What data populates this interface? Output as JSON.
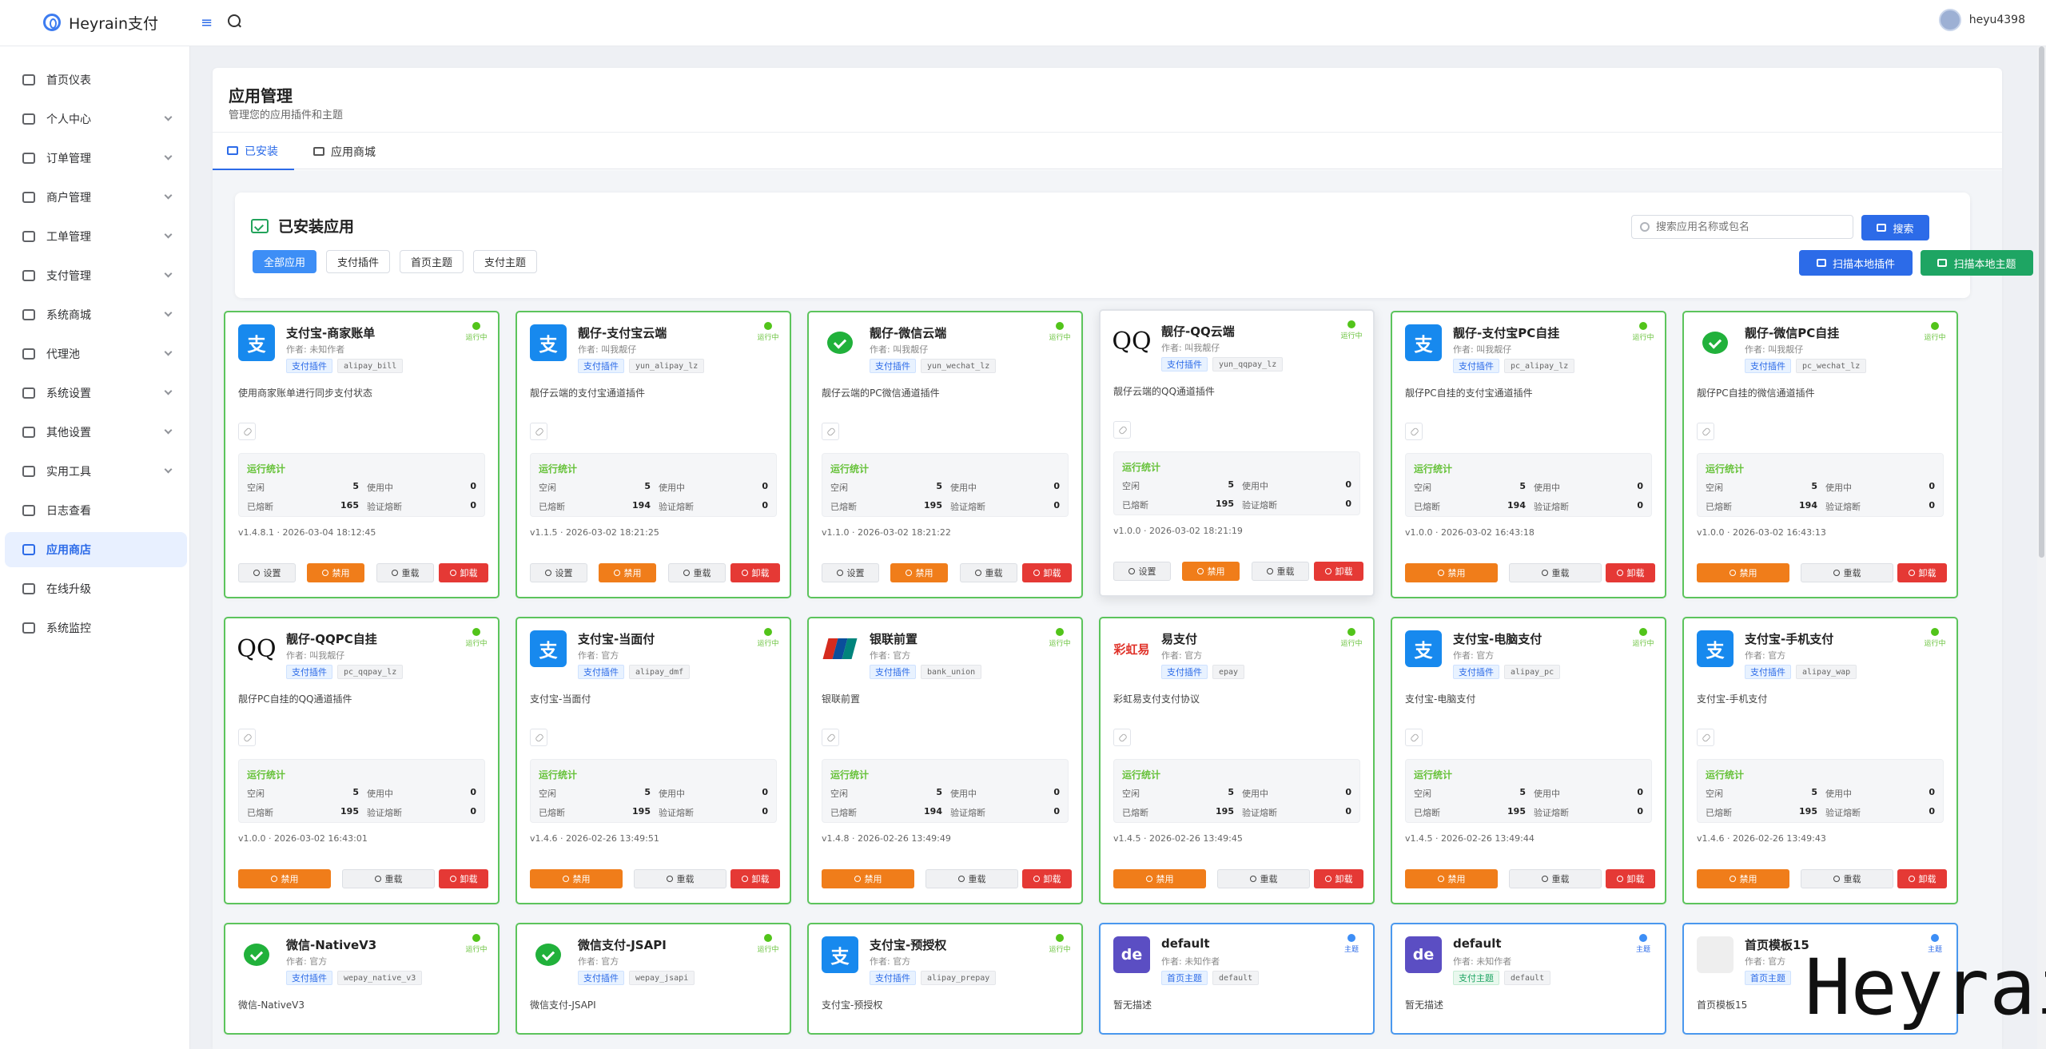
{
  "app": {
    "name": "Heyrain支付",
    "user": "heyu4398"
  },
  "sidebar": {
    "items": [
      {
        "label": "首页仪表",
        "icon": "grid-icon",
        "expand": false
      },
      {
        "label": "个人中心",
        "icon": "user-icon",
        "expand": true
      },
      {
        "label": "订单管理",
        "icon": "database-icon",
        "expand": true
      },
      {
        "label": "商户管理",
        "icon": "users-icon",
        "expand": true
      },
      {
        "label": "工单管理",
        "icon": "ticket-icon",
        "expand": true
      },
      {
        "label": "支付管理",
        "icon": "wallet-icon",
        "expand": true
      },
      {
        "label": "系统商城",
        "icon": "shop-icon",
        "expand": true
      },
      {
        "label": "代理池",
        "icon": "send-icon",
        "expand": true
      },
      {
        "label": "系统设置",
        "icon": "gear-icon",
        "expand": true
      },
      {
        "label": "其他设置",
        "icon": "box-icon",
        "expand": true
      },
      {
        "label": "实用工具",
        "icon": "link-icon",
        "expand": true
      },
      {
        "label": "日志查看",
        "icon": "log-icon",
        "expand": false
      },
      {
        "label": "应用商店",
        "icon": "store-icon",
        "expand": false,
        "active": true
      },
      {
        "label": "在线升级",
        "icon": "upgrade-icon",
        "expand": false
      },
      {
        "label": "系统监控",
        "icon": "monitor-icon",
        "expand": false
      }
    ]
  },
  "page": {
    "title": "应用管理",
    "subtitle": "管理您的应用插件和主题",
    "tabs": [
      {
        "label": "已安装",
        "active": true
      },
      {
        "label": "应用商城",
        "active": false
      }
    ]
  },
  "installed": {
    "title": "已安装应用",
    "filters": [
      "全部应用",
      "支付插件",
      "首页主题",
      "支付主题"
    ],
    "search_placeholder": "搜索应用名称或包名",
    "search_btn": "搜索",
    "scan_plugin_btn": "扫描本地插件",
    "scan_theme_btn": "扫描本地主题"
  },
  "labels": {
    "stats": "运行统计",
    "idle": "空闲",
    "in_use": "使用中",
    "banned": "已熔断",
    "verify_banned": "验证熔断",
    "settings": "设置",
    "disable": "禁用",
    "reload": "重载",
    "uninstall": "卸载",
    "running": "运行中",
    "theme": "主题"
  },
  "cards": [
    {
      "name": "支付宝-商家账单",
      "author": "作者: 未知作者",
      "tag": "支付插件",
      "code": "alipay_bill",
      "desc": "使用商家账单进行同步支付状态",
      "idle": "5",
      "in_use": "0",
      "banned": "165",
      "verify": "0",
      "version": "v1.4.8.1",
      "time": "2026-03-04 18:12:45",
      "logo": "alipay",
      "logo_text": "支",
      "settings": true
    },
    {
      "name": "靓仔-支付宝云端",
      "author": "作者: 叫我靓仔",
      "tag": "支付插件",
      "code": "yun_alipay_lz",
      "desc": "靓仔云端的支付宝通道插件",
      "idle": "5",
      "in_use": "0",
      "banned": "194",
      "verify": "0",
      "version": "v1.1.5",
      "time": "2026-03-02 18:21:25",
      "logo": "alipay",
      "logo_text": "支",
      "settings": true
    },
    {
      "name": "靓仔-微信云端",
      "author": "作者: 叫我靓仔",
      "tag": "支付插件",
      "code": "yun_wechat_lz",
      "desc": "靓仔云端的PC微信通道插件",
      "idle": "5",
      "in_use": "0",
      "banned": "195",
      "verify": "0",
      "version": "v1.1.0",
      "time": "2026-03-02 18:21:22",
      "logo": "wechat",
      "logo_text": "",
      "settings": true
    },
    {
      "name": "靓仔-QQ云端",
      "author": "作者: 叫我靓仔",
      "tag": "支付插件",
      "code": "yun_qqpay_lz",
      "desc": "靓仔云端的QQ通道插件",
      "idle": "5",
      "in_use": "0",
      "banned": "195",
      "verify": "0",
      "version": "v1.0.0",
      "time": "2026-03-02 18:21:19",
      "logo": "qq",
      "logo_text": "QQ",
      "settings": true
    },
    {
      "name": "靓仔-支付宝PC自挂",
      "author": "作者: 叫我靓仔",
      "tag": "支付插件",
      "code": "pc_alipay_lz",
      "desc": "靓仔PC自挂的支付宝通道插件",
      "idle": "5",
      "in_use": "0",
      "banned": "194",
      "verify": "0",
      "version": "v1.0.0",
      "time": "2026-03-02 16:43:18",
      "logo": "alipay",
      "logo_text": "支",
      "settings": false
    },
    {
      "name": "靓仔-微信PC自挂",
      "author": "作者: 叫我靓仔",
      "tag": "支付插件",
      "code": "pc_wechat_lz",
      "desc": "靓仔PC自挂的微信通道插件",
      "idle": "5",
      "in_use": "0",
      "banned": "194",
      "verify": "0",
      "version": "v1.0.0",
      "time": "2026-03-02 16:43:13",
      "logo": "wechat",
      "logo_text": "",
      "settings": false
    },
    {
      "name": "靓仔-QQPC自挂",
      "author": "作者: 叫我靓仔",
      "tag": "支付插件",
      "code": "pc_qqpay_lz",
      "desc": "靓仔PC自挂的QQ通道插件",
      "idle": "5",
      "in_use": "0",
      "banned": "195",
      "verify": "0",
      "version": "v1.0.0",
      "time": "2026-03-02 16:43:01",
      "logo": "qq",
      "logo_text": "QQ",
      "settings": false
    },
    {
      "name": "支付宝-当面付",
      "author": "作者: 官方",
      "tag": "支付插件",
      "code": "alipay_dmf",
      "desc": "支付宝-当面付",
      "idle": "5",
      "in_use": "0",
      "banned": "195",
      "verify": "0",
      "version": "v1.4.6",
      "time": "2026-02-26 13:49:51",
      "logo": "alipay",
      "logo_text": "支",
      "settings": false
    },
    {
      "name": "银联前置",
      "author": "作者: 官方",
      "tag": "支付插件",
      "code": "bank_union",
      "desc": "银联前置",
      "idle": "5",
      "in_use": "0",
      "banned": "194",
      "verify": "0",
      "version": "v1.4.8",
      "time": "2026-02-26 13:49:49",
      "logo": "union",
      "logo_text": "",
      "settings": false
    },
    {
      "name": "易支付",
      "author": "作者: 官方",
      "tag": "支付插件",
      "code": "epay",
      "desc": "彩虹易支付支付协议",
      "idle": "5",
      "in_use": "0",
      "banned": "195",
      "verify": "0",
      "version": "v1.4.5",
      "time": "2026-02-26 13:49:45",
      "logo": "epay",
      "logo_text": "彩虹易",
      "settings": false
    },
    {
      "name": "支付宝-电脑支付",
      "author": "作者: 官方",
      "tag": "支付插件",
      "code": "alipay_pc",
      "desc": "支付宝-电脑支付",
      "idle": "5",
      "in_use": "0",
      "banned": "195",
      "verify": "0",
      "version": "v1.4.5",
      "time": "2026-02-26 13:49:44",
      "logo": "alipay",
      "logo_text": "支",
      "settings": false
    },
    {
      "name": "支付宝-手机支付",
      "author": "作者: 官方",
      "tag": "支付插件",
      "code": "alipay_wap",
      "desc": "支付宝-手机支付",
      "idle": "5",
      "in_use": "0",
      "banned": "195",
      "verify": "0",
      "version": "v1.4.6",
      "time": "2026-02-26 13:49:43",
      "logo": "alipay",
      "logo_text": "支",
      "settings": false
    },
    {
      "name": "微信-NativeV3",
      "author": "作者: 官方",
      "tag": "支付插件",
      "code": "wepay_native_v3",
      "desc": "微信-NativeV3",
      "logo": "wechat",
      "logo_text": "",
      "theme": false
    },
    {
      "name": "微信支付-JSAPI",
      "author": "作者: 官方",
      "tag": "支付插件",
      "code": "wepay_jsapi",
      "desc": "微信支付-JSAPI",
      "logo": "wechat",
      "logo_text": "",
      "theme": false
    },
    {
      "name": "支付宝-预授权",
      "author": "作者: 官方",
      "tag": "支付插件",
      "code": "alipay_prepay",
      "desc": "支付宝-预授权",
      "logo": "alipay",
      "logo_text": "支",
      "theme": false
    },
    {
      "name": "default",
      "author": "作者: 未知作者",
      "tag": "首页主题",
      "code": "default",
      "desc": "暂无描述",
      "logo": "de",
      "logo_text": "de",
      "theme": true
    },
    {
      "name": "default",
      "author": "作者: 未知作者",
      "tag": "支付主题",
      "code": "default",
      "desc": "暂无描述",
      "logo": "de",
      "logo_text": "de",
      "theme": true
    },
    {
      "name": "首页模板15",
      "author": "作者: 官方",
      "tag": "首页主题",
      "code": "",
      "desc": "首页模板15",
      "logo": "tpl",
      "logo_text": "",
      "theme": true
    }
  ],
  "watermark": "Heyrain",
  "colors": {
    "primary": "#2c6be8",
    "success": "#1ea563",
    "warning": "#f07d1a",
    "danger": "#e53935",
    "card_border": "#5cc45c"
  }
}
